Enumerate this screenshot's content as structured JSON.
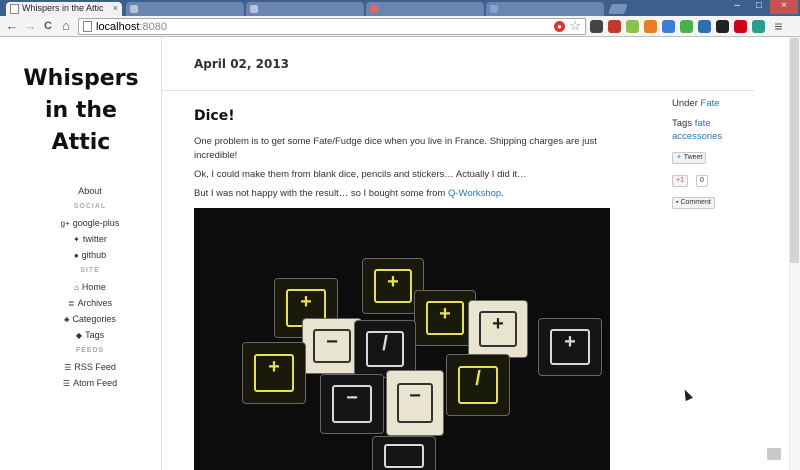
{
  "browser": {
    "active_tab_title": "Whispers in the Attic",
    "url_host": "localhost",
    "url_port": ":8080",
    "close_glyph": "×",
    "new_tab_glyph": "+",
    "window_controls": [
      "–",
      "□",
      "×"
    ],
    "nav_buttons": {
      "back": "←",
      "forward": "→",
      "reload": "C",
      "home": "⌂"
    },
    "star_glyph": "☆",
    "menu_glyph": "≡"
  },
  "sidebar": {
    "title_lines": [
      "Whispers",
      "in the",
      "Attic"
    ],
    "about": "About",
    "social_header": "SOCIAL",
    "social": [
      {
        "icon": "google-plus-icon",
        "glyph": "g+",
        "label": "google-plus"
      },
      {
        "icon": "twitter-icon",
        "glyph": "🐦",
        "label": "twitter"
      },
      {
        "icon": "github-icon",
        "glyph": "●",
        "label": "github"
      }
    ],
    "site_header": "SITE",
    "site": [
      {
        "icon": "home-icon",
        "glyph": "⌂",
        "label": "Home"
      },
      {
        "icon": "archives-icon",
        "glyph": "≣",
        "label": "Archives"
      },
      {
        "icon": "categories-icon",
        "glyph": "♣",
        "label": "Categories"
      },
      {
        "icon": "tags-icon",
        "glyph": "◆",
        "label": "Tags"
      }
    ],
    "feeds_header": "FEEDS",
    "feeds": [
      {
        "icon": "rss-icon",
        "glyph": "☰",
        "label": "RSS Feed"
      },
      {
        "icon": "atom-icon",
        "glyph": "☰",
        "label": "Atom Feed"
      }
    ]
  },
  "post": {
    "date": "April 02, 2013",
    "title": "Dice!",
    "p1": "One problem is to get some Fate/Fudge dice when you live in France. Shipping charges are just incredible!",
    "p2": "Ok, I could make them from blank dice, pencils and stickers… Actually I did it…",
    "p3_prefix": "But I was not happy with the result… so I bought some from ",
    "p3_link": "Q-Workshop",
    "p3_suffix": "."
  },
  "meta": {
    "under_label": "Under",
    "category": "Fate",
    "tags_label": "Tags",
    "tags": [
      "fate",
      "accessories"
    ],
    "tweet_label": "Tweet",
    "plusone_label": "+1",
    "plusone_count": "0",
    "comment_label": "Comment"
  }
}
